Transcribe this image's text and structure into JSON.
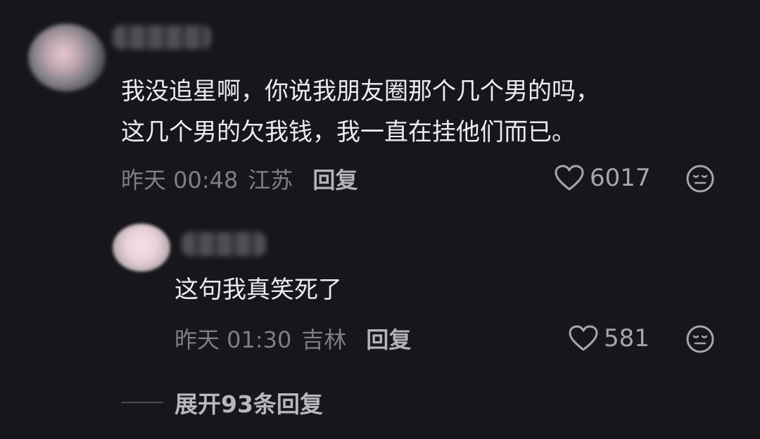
{
  "comment": {
    "text_lines": [
      "我没追星啊，你说我朋友圈那个几个男的吗，",
      "这几个男的欠我钱，我一直在挂他们而已。"
    ],
    "time": "昨天 00:48",
    "location": "江苏",
    "reply_label": "回复",
    "likes": "6017"
  },
  "reply": {
    "text": "这句我真笑死了",
    "time": "昨天 01:30",
    "location": "吉林",
    "reply_label": "回复",
    "likes": "581"
  },
  "expand_label": "展开93条回复",
  "icons": {
    "like": "heart-outline-icon",
    "emoji": "neutral-face-icon"
  },
  "colors": {
    "background": "#17161c",
    "text": "#ececf0",
    "meta": "#7f7e86"
  }
}
